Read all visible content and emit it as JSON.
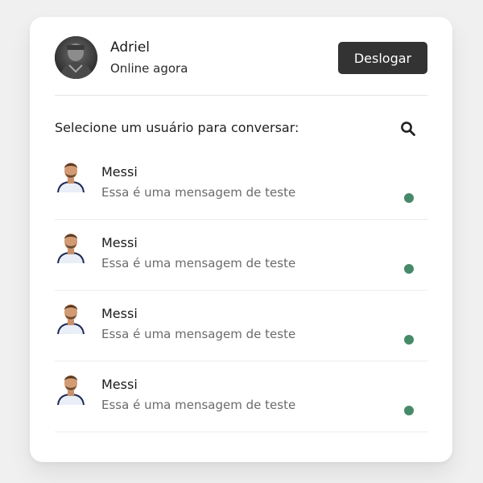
{
  "header": {
    "user_name": "Adriel",
    "status": "Online agora",
    "logout_label": "Deslogar"
  },
  "search": {
    "prompt": "Selecione um usuário para conversar:",
    "icon": "search-icon"
  },
  "contacts": [
    {
      "name": "Messi",
      "message": "Essa é uma mensagem de teste",
      "online": true
    },
    {
      "name": "Messi",
      "message": "Essa é uma mensagem de teste",
      "online": true
    },
    {
      "name": "Messi",
      "message": "Essa é uma mensagem de teste",
      "online": true
    },
    {
      "name": "Messi",
      "message": "Essa é uma mensagem de teste",
      "online": true
    }
  ],
  "colors": {
    "online_dot": "#468a6a",
    "logout_bg": "#333333",
    "card_bg": "#ffffff",
    "page_bg": "#f0f0f0"
  }
}
